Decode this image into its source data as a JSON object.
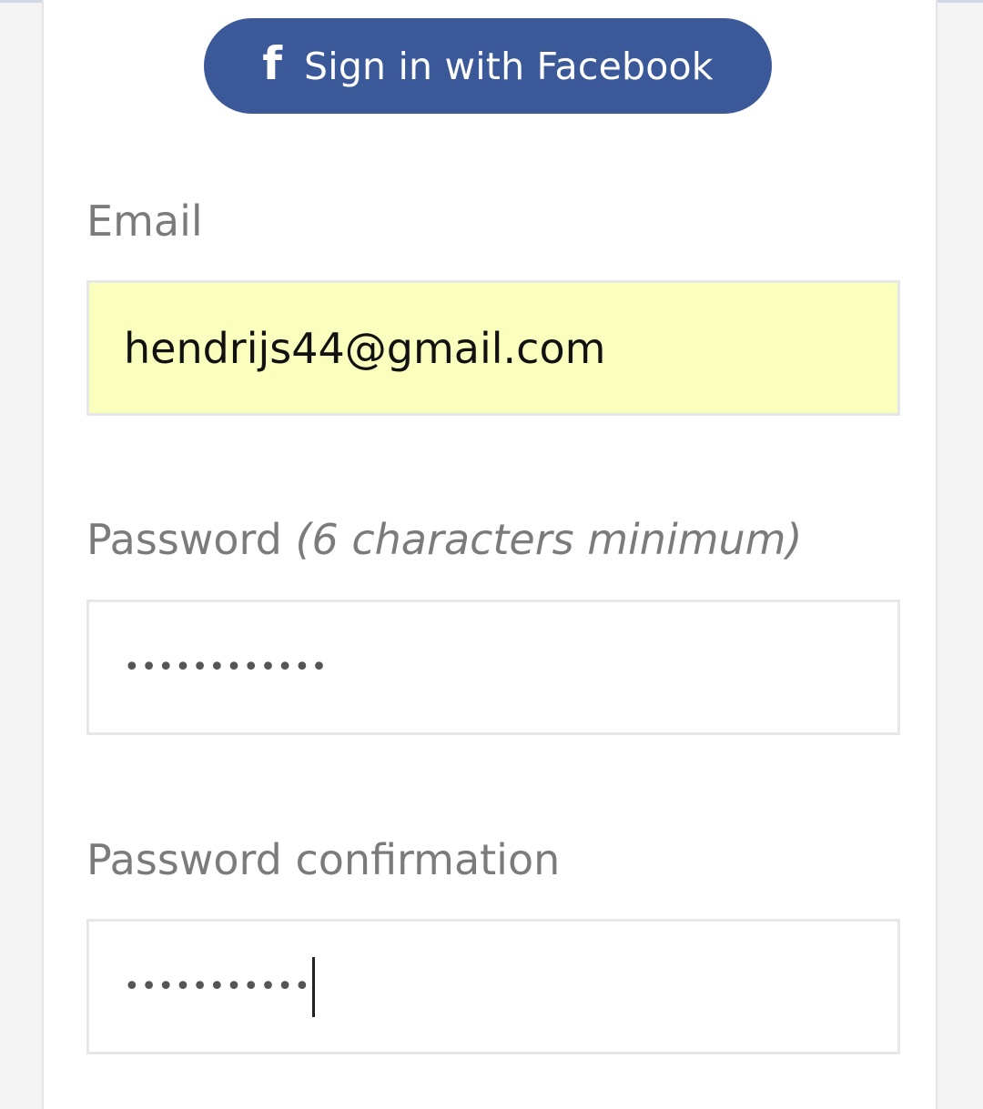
{
  "facebook": {
    "icon": "facebook-f-icon",
    "icon_glyph": "f",
    "label": "Sign in with Facebook",
    "color": "#3b5998"
  },
  "email": {
    "label": "Email",
    "value": "hendrijs44@gmail.com",
    "autofill_color": "#faffbd"
  },
  "password": {
    "label": "Password",
    "hint": "(6 characters minimum)",
    "value": "••••••••••••"
  },
  "password_confirmation": {
    "label": "Password confirmation",
    "value": "•••••••••••"
  }
}
